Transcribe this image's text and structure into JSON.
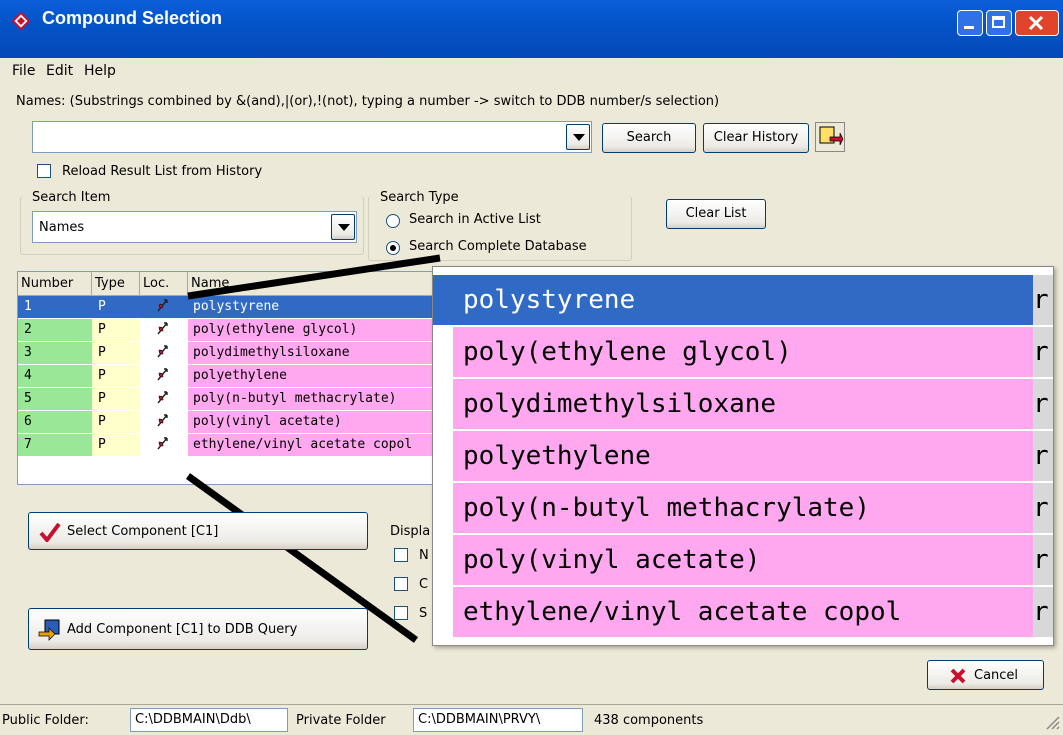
{
  "window": {
    "title": "Compound Selection"
  },
  "menu": {
    "items": [
      "File",
      "Edit",
      "Help"
    ]
  },
  "names_label": "Names: (Substrings combined by &(and),|(or),!(not), typing a number -> switch to DDB number/s selection)",
  "search": {
    "value": "",
    "search_button": "Search",
    "clear_history_button": "Clear History"
  },
  "reload_label": "Reload Result List from History",
  "search_item": {
    "label": "Search Item",
    "value": "Names"
  },
  "search_type": {
    "label": "Search Type",
    "options": [
      "Search in  Active List",
      "Search Complete Database"
    ],
    "selected": "Search Complete Database"
  },
  "clear_list_button": "Clear List",
  "table": {
    "headers": [
      "Number",
      "Type",
      "Loc.",
      "Name"
    ],
    "rows": [
      {
        "number": "1",
        "type": "P",
        "name": "polystyrene"
      },
      {
        "number": "2",
        "type": "P",
        "name": "poly(ethylene glycol)"
      },
      {
        "number": "3",
        "type": "P",
        "name": "polydimethylsiloxane"
      },
      {
        "number": "4",
        "type": "P",
        "name": "polyethylene"
      },
      {
        "number": "5",
        "type": "P",
        "name": "poly(n-butyl methacrylate)"
      },
      {
        "number": "6",
        "type": "P",
        "name": "poly(vinyl acetate)"
      },
      {
        "number": "7",
        "type": "P",
        "name": "ethylene/vinyl acetate copol"
      }
    ],
    "selected_row": 0
  },
  "zoom_edge_char": "r",
  "select_component_button": "Select Component [C1]",
  "add_component_button": "Add Component [C1] to DDB Query",
  "display_group_label": "Displa",
  "display_options": [
    "N",
    "C",
    "S"
  ],
  "cancel_button": "Cancel",
  "status": {
    "public_label": "Public Folder:",
    "public_value": "C:\\DDBMAIN\\Ddb\\",
    "private_label": "Private Folder",
    "private_value": "C:\\DDBMAIN\\PRVY\\",
    "count": "438 components"
  },
  "colors": {
    "selected": "#316AC5",
    "name_bg": "#FFA8F0",
    "number_bg": "#98E898",
    "type_bg": "#FFFFCC"
  }
}
